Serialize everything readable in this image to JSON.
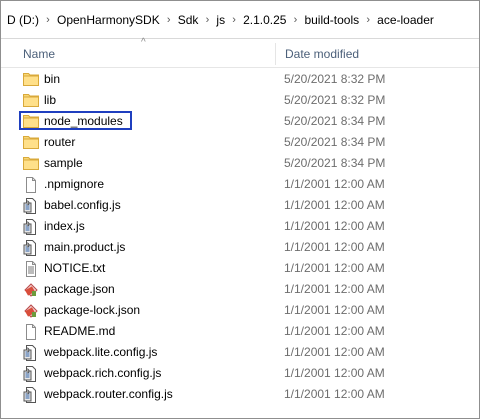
{
  "breadcrumb": [
    "D (D:)",
    "OpenHarmonySDK",
    "Sdk",
    "js",
    "2.1.0.25",
    "build-tools",
    "ace-loader"
  ],
  "breadcrumb_separator": "›",
  "columns": {
    "name": "Name",
    "date_modified": "Date modified",
    "sort_indicator": "^"
  },
  "highlight_color": "#1f3fbf",
  "files": [
    {
      "name": "bin",
      "date": "5/20/2021 8:32 PM",
      "icon": "folder-icon"
    },
    {
      "name": "lib",
      "date": "5/20/2021 8:32 PM",
      "icon": "folder-icon"
    },
    {
      "name": "node_modules",
      "date": "5/20/2021 8:34 PM",
      "icon": "folder-icon",
      "highlighted": true
    },
    {
      "name": "router",
      "date": "5/20/2021 8:34 PM",
      "icon": "folder-icon"
    },
    {
      "name": "sample",
      "date": "5/20/2021 8:34 PM",
      "icon": "folder-icon"
    },
    {
      "name": ".npmignore",
      "date": "1/1/2001 12:00 AM",
      "icon": "blank-file-icon"
    },
    {
      "name": "babel.config.js",
      "date": "1/1/2001 12:00 AM",
      "icon": "script-file-icon"
    },
    {
      "name": "index.js",
      "date": "1/1/2001 12:00 AM",
      "icon": "script-file-icon"
    },
    {
      "name": "main.product.js",
      "date": "1/1/2001 12:00 AM",
      "icon": "script-file-icon"
    },
    {
      "name": "NOTICE.txt",
      "date": "1/1/2001 12:00 AM",
      "icon": "text-file-icon"
    },
    {
      "name": "package.json",
      "date": "1/1/2001 12:00 AM",
      "icon": "json-file-icon"
    },
    {
      "name": "package-lock.json",
      "date": "1/1/2001 12:00 AM",
      "icon": "json-file-icon"
    },
    {
      "name": "README.md",
      "date": "1/1/2001 12:00 AM",
      "icon": "blank-file-icon"
    },
    {
      "name": "webpack.lite.config.js",
      "date": "1/1/2001 12:00 AM",
      "icon": "script-file-icon"
    },
    {
      "name": "webpack.rich.config.js",
      "date": "1/1/2001 12:00 AM",
      "icon": "script-file-icon"
    },
    {
      "name": "webpack.router.config.js",
      "date": "1/1/2001 12:00 AM",
      "icon": "script-file-icon"
    }
  ]
}
